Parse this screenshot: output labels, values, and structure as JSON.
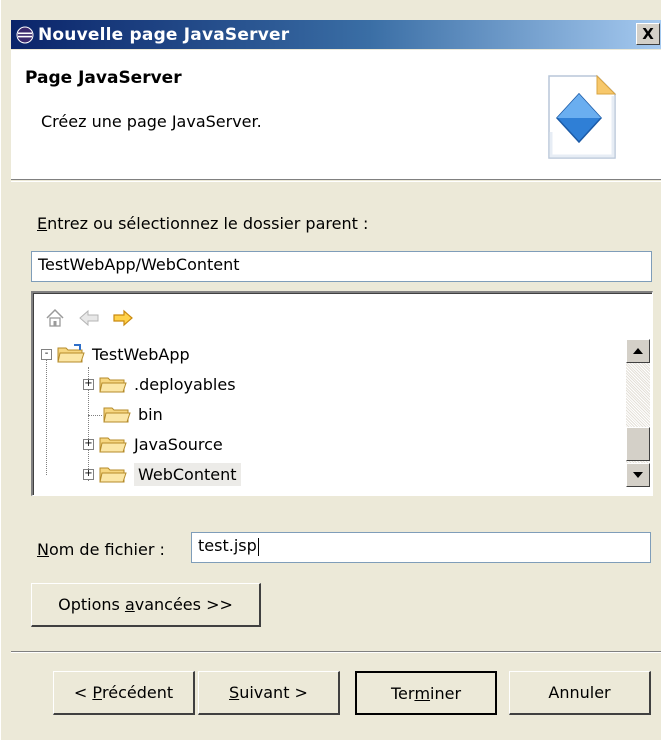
{
  "window": {
    "title": "Nouvelle page JavaServer",
    "close_glyph": "X"
  },
  "header": {
    "title": "Page JavaServer",
    "description": "Créez une page JavaServer."
  },
  "parent_folder": {
    "label_prefix": "E",
    "label_rest": "ntrez ou sélectionnez le dossier parent :",
    "value": "TestWebApp/WebContent"
  },
  "tree": {
    "toolbar": [
      "home-icon",
      "back-arrow-icon",
      "forward-arrow-icon"
    ],
    "items": [
      {
        "label": "TestWebApp",
        "expander": "-",
        "level": 0,
        "selected": false
      },
      {
        "label": ".deployables",
        "expander": "+",
        "level": 1,
        "selected": false
      },
      {
        "label": "bin",
        "expander": "",
        "level": 1,
        "selected": false
      },
      {
        "label": "JavaSource",
        "expander": "+",
        "level": 1,
        "selected": false
      },
      {
        "label": "WebContent",
        "expander": "+",
        "level": 1,
        "selected": true
      }
    ]
  },
  "filename": {
    "label_prefix": "N",
    "label_rest": "om de fichier :",
    "value": "test.jsp"
  },
  "buttons": {
    "advanced_pre": "Options ",
    "advanced_ul": "a",
    "advanced_post": "vancées >>",
    "prev_pre": "< ",
    "prev_ul": "P",
    "prev_post": "récédent",
    "next_ul": "S",
    "next_post": "uivant >",
    "finish_pre": "Ter",
    "finish_ul": "m",
    "finish_post": "iner",
    "cancel": "Annuler"
  },
  "colors": {
    "titlebar_start": "#0a246a",
    "titlebar_end": "#a6caf0",
    "dialog_bg": "#ece9d8"
  }
}
